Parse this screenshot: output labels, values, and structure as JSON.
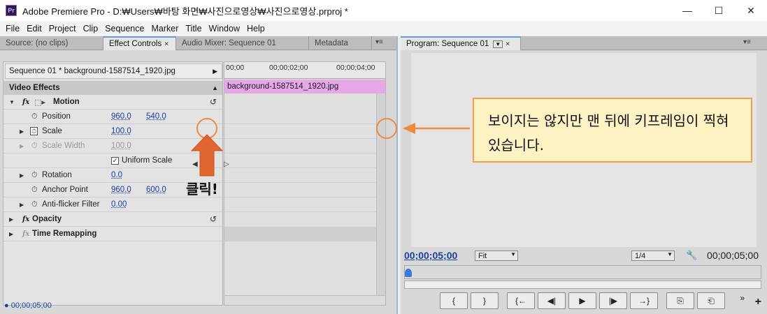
{
  "window": {
    "title": "Adobe Premiere Pro - D:₩Users₩바탕 화면₩사진으로영상₩사진으로영상.prproj *",
    "icon_text": "Pr",
    "minimize": "—",
    "maximize": "☐",
    "close": "✕"
  },
  "menu": [
    "File",
    "Edit",
    "Project",
    "Clip",
    "Sequence",
    "Marker",
    "Title",
    "Window",
    "Help"
  ],
  "left_tabs": [
    {
      "label": "Source: (no clips)"
    },
    {
      "label": "Effect Controls",
      "close": "×"
    },
    {
      "label": "Audio Mixer: Sequence 01"
    },
    {
      "label": "Metadata"
    }
  ],
  "right_tabs": [
    {
      "label": "Program: Sequence 01",
      "close": "×"
    }
  ],
  "panel_menu_icon": "▾≡",
  "effect_controls": {
    "sequence_clip": "Sequence 01 * background-1587514_1920.jpg",
    "video_effects_label": "Video Effects",
    "motion_label": "Motion",
    "position_label": "Position",
    "position_x": "960.0",
    "position_y": "540.0",
    "scale_label": "Scale",
    "scale_value": "100.0",
    "scale_width_label": "Scale Width",
    "scale_width_value": "100.0",
    "uniform_scale_label": "Uniform Scale",
    "rotation_label": "Rotation",
    "rotation_value": "0.0",
    "anchor_label": "Anchor Point",
    "anchor_x": "960.0",
    "anchor_y": "600.0",
    "antiflicker_label": "Anti-flicker Filter",
    "antiflicker_value": "0.00",
    "opacity_label": "Opacity",
    "time_remap_label": "Time Remapping",
    "status_timecode": "00;00;05;00",
    "fx_symbol": "fx"
  },
  "timeline": {
    "ticks": [
      "00;00",
      "00;00;02;00",
      "00;00;04;00"
    ],
    "clip_name": "background-1587514_1920.jpg"
  },
  "annotations": {
    "click_label": "클릭!",
    "callout_text": "보이지는 않지만 맨 뒤에 키프레임이 찍혀 있습니다."
  },
  "program": {
    "timecode_current": "00;00;05;00",
    "fit_option": "Fit",
    "resolution": "1/4",
    "timecode_duration": "00;00;05;00",
    "transport": [
      "{",
      "}",
      "{←",
      "◀|",
      "▶",
      "|▶",
      "→}",
      "⎘",
      "⎗"
    ]
  },
  "colors": {
    "accent_orange": "#f08a3c",
    "clip_pink": "#e6a8e6",
    "timecode_blue": "#1a3fa0",
    "callout_bg": "#fdf2c4"
  }
}
